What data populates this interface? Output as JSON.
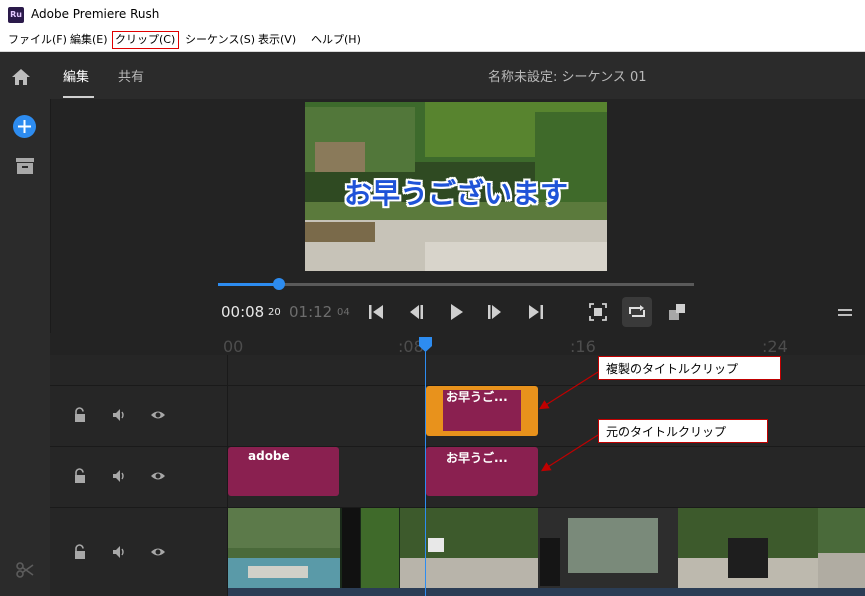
{
  "window": {
    "title": "Adobe Premiere Rush",
    "logo_text": "Ru"
  },
  "menu": [
    {
      "label": "ファイル(F)",
      "highlighted": false
    },
    {
      "label": "編集(E)",
      "highlighted": false
    },
    {
      "label": "クリップ(C)",
      "highlighted": true
    },
    {
      "label": "シーケンス(S)",
      "highlighted": false
    },
    {
      "label": "表示(V)",
      "highlighted": false
    },
    {
      "label": "ヘルプ(H)",
      "highlighted": false
    }
  ],
  "nav": {
    "tab_edit": "編集",
    "tab_share": "共有",
    "active_tab": "編集",
    "sequence_title": "名称未設定: シーケンス 01"
  },
  "sidebar_icons": [
    "home-icon",
    "add-icon",
    "archive-icon",
    "scissors-icon"
  ],
  "preview": {
    "caption": "お早うございます"
  },
  "playback": {
    "current_time": "00:08",
    "current_frame": "20",
    "duration": "01:12",
    "duration_frame": "04",
    "progress": 0.12,
    "controls": [
      "skip-to-start-icon",
      "step-back-icon",
      "play-icon",
      "step-forward-icon",
      "skip-to-end-icon",
      "fit-frame-icon",
      "loop-icon",
      "aspect-icon",
      "menu-icon"
    ]
  },
  "timeline": {
    "ruler_labels": [
      "00",
      ":08",
      ":16",
      ":24"
    ],
    "tracks": [
      {
        "name": "title-track-2",
        "clips": [
          {
            "label": "お早うご...",
            "color": "#e8921c",
            "selected": true
          }
        ]
      },
      {
        "name": "title-track-1",
        "clips": [
          {
            "label": "adobe",
            "color": "#8a2050"
          },
          {
            "label": "お早うご...",
            "color": "#8a2050"
          }
        ]
      },
      {
        "name": "video-track",
        "clips": []
      }
    ],
    "track_icons": [
      "lock-icon",
      "volume-icon",
      "eye-icon"
    ]
  },
  "annotations": [
    {
      "label": "複製のタイトルクリップ"
    },
    {
      "label": "元のタイトルクリップ"
    }
  ],
  "colors": {
    "accent": "#2d8cf0",
    "clip": "#8a2050",
    "selected_clip": "#e8921c",
    "callout_border": "#c00000"
  }
}
